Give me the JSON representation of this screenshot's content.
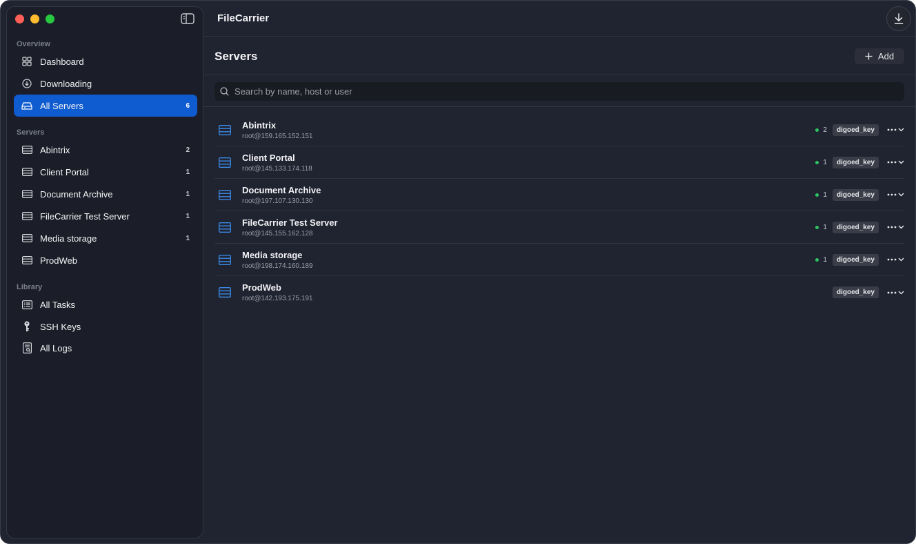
{
  "app": {
    "title": "FileCarrier"
  },
  "sidebar": {
    "sections": [
      {
        "label": "Overview"
      },
      {
        "label": "Servers"
      },
      {
        "label": "Library"
      }
    ],
    "overview": [
      {
        "label": "Dashboard",
        "icon": "grid-icon"
      },
      {
        "label": "Downloading",
        "icon": "download-circle-icon"
      },
      {
        "label": "All Servers",
        "icon": "servers-icon",
        "count": "6",
        "active": true
      }
    ],
    "servers": [
      {
        "label": "Abintrix",
        "count": "2"
      },
      {
        "label": "Client Portal",
        "count": "1"
      },
      {
        "label": "Document Archive",
        "count": "1"
      },
      {
        "label": "FileCarrier Test Server",
        "count": "1"
      },
      {
        "label": "Media storage",
        "count": "1"
      },
      {
        "label": "ProdWeb",
        "count": ""
      }
    ],
    "library": [
      {
        "label": "All Tasks",
        "icon": "tasks-icon"
      },
      {
        "label": "SSH Keys",
        "icon": "key-icon"
      },
      {
        "label": "All Logs",
        "icon": "logs-icon"
      }
    ]
  },
  "main": {
    "page_title": "Servers",
    "add_label": "Add",
    "search_placeholder": "Search by name, host or user",
    "servers": [
      {
        "name": "Abintrix",
        "host": "root@159.165.152.151",
        "connections": "2",
        "key": "digoed_key"
      },
      {
        "name": "Client Portal",
        "host": "root@145.133.174.118",
        "connections": "1",
        "key": "digoed_key"
      },
      {
        "name": "Document Archive",
        "host": "root@197.107.130.130",
        "connections": "1",
        "key": "digoed_key"
      },
      {
        "name": "FileCarrier Test Server",
        "host": "root@145.155.162.128",
        "connections": "1",
        "key": "digoed_key"
      },
      {
        "name": "Media storage",
        "host": "root@198.174.160.189",
        "connections": "1",
        "key": "digoed_key"
      },
      {
        "name": "ProdWeb",
        "host": "root@142.193.175.191",
        "connections": "",
        "key": "digoed_key"
      }
    ]
  },
  "colors": {
    "accent": "#0f5bd0",
    "server_icon": "#3b8ce8",
    "online": "#2ec463"
  }
}
